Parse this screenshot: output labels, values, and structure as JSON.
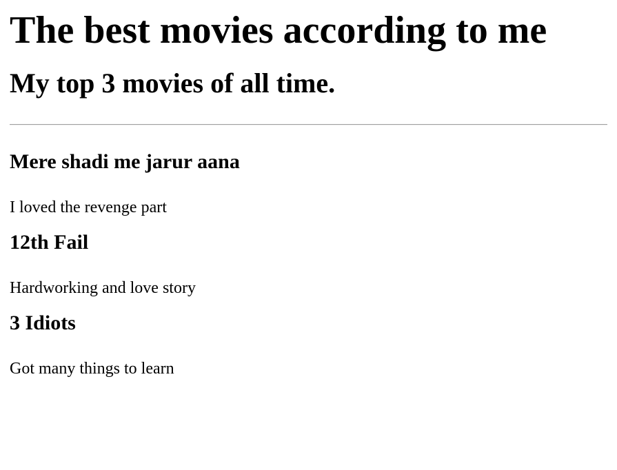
{
  "header": {
    "title": "The best movies according to me",
    "subtitle": "My top 3 movies of all time."
  },
  "movies": [
    {
      "title": "Mere shadi me jarur aana",
      "description": "I loved the revenge part"
    },
    {
      "title": "12th Fail",
      "description": "Hardworking and love story"
    },
    {
      "title": "3 Idiots",
      "description": "Got many things to learn"
    }
  ]
}
